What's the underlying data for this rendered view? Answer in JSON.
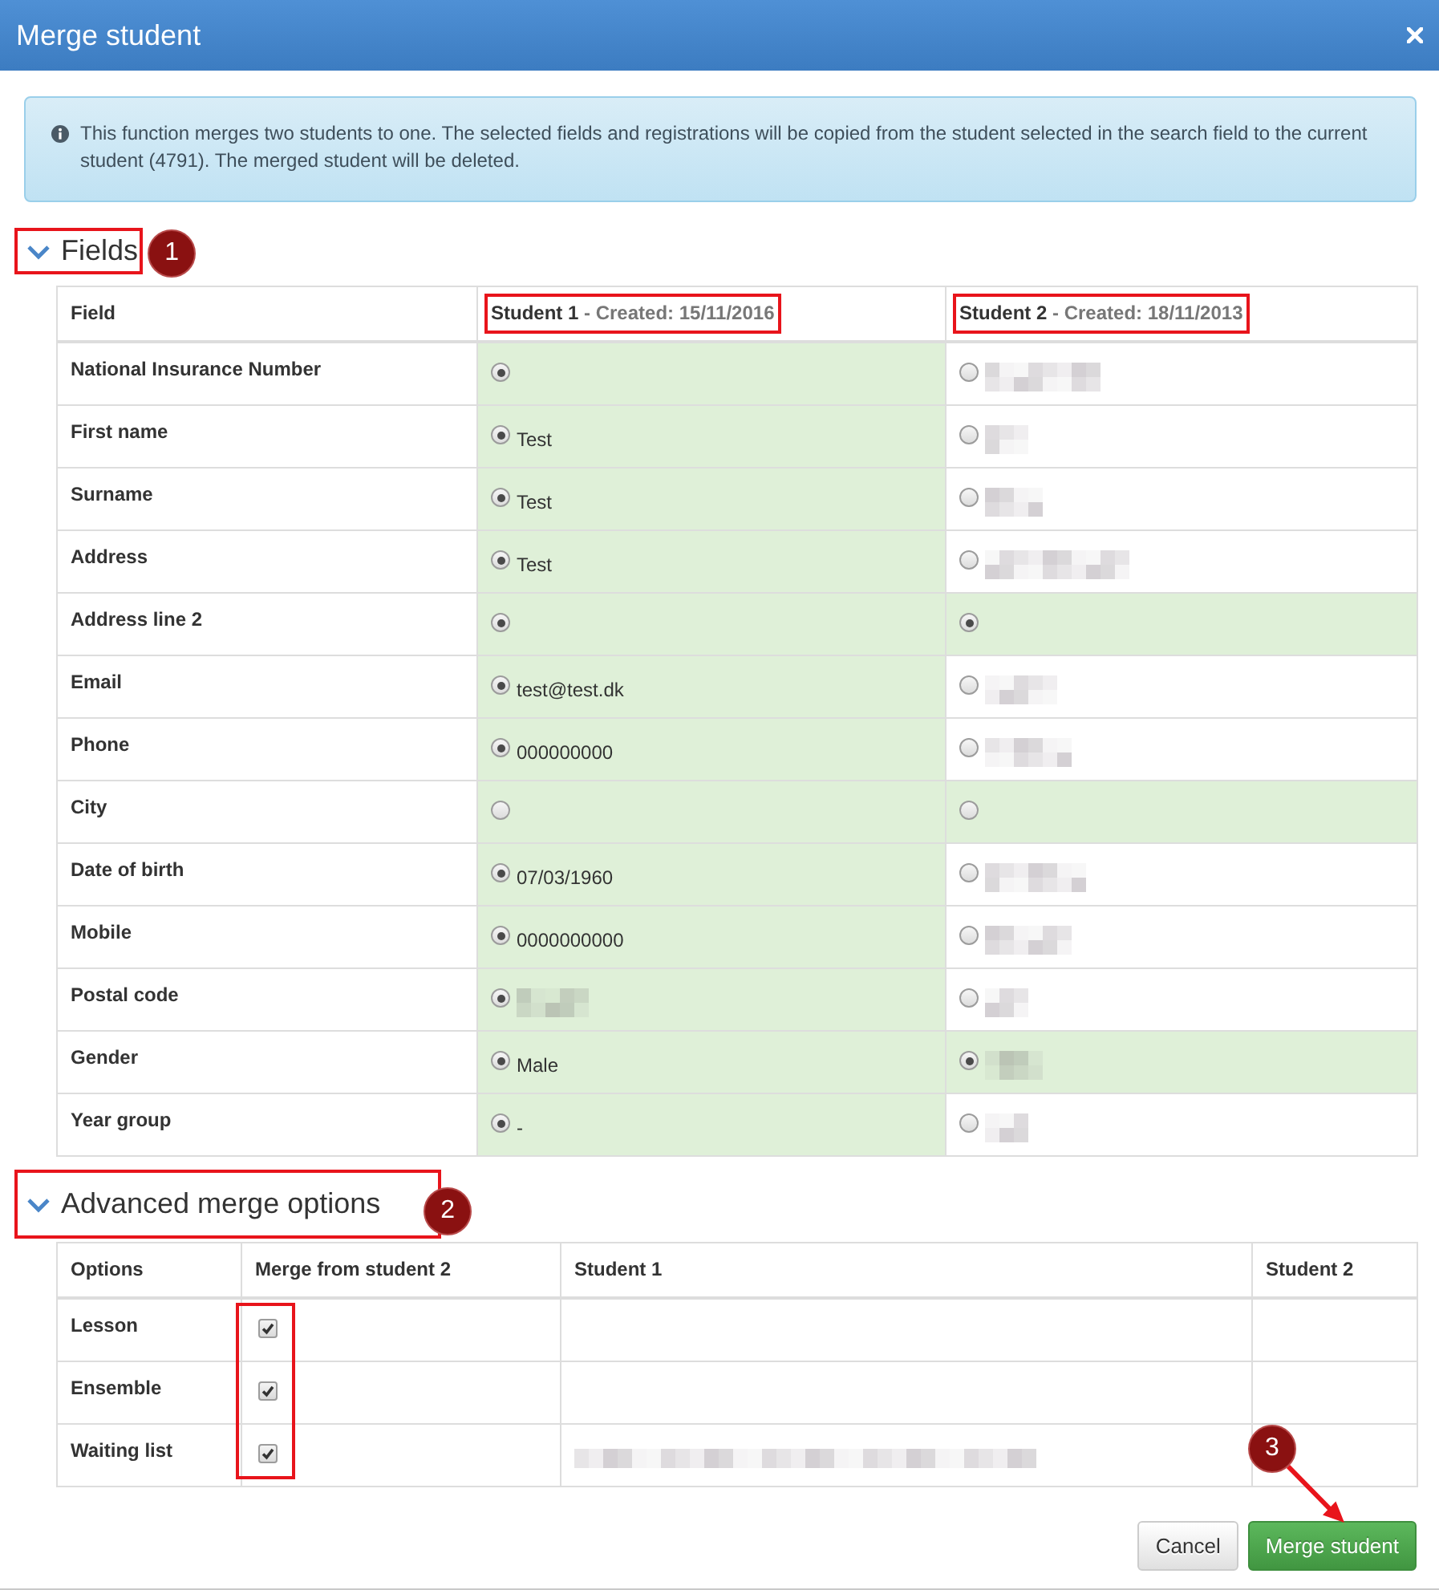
{
  "dialog": {
    "title": "Merge student"
  },
  "info": {
    "text": "This function merges two students to one. The selected fields and registrations will be copied from the student selected in the search field to the current student (4791). The merged student will be deleted."
  },
  "fields_section": {
    "title": "Fields",
    "expanded": true,
    "annotated": true,
    "badge": "1",
    "columns": [
      {
        "label": "Field",
        "annotated": false
      },
      {
        "label": "Student 1",
        "created": "- Created: 15/11/2016",
        "annotated": true
      },
      {
        "label": "Student 2",
        "created": "- Created: 18/11/2013",
        "annotated": true
      }
    ],
    "rows": [
      {
        "field": "National Insurance Number",
        "student_1": {
          "selected": true,
          "highlighted": true
        },
        "student_2": {
          "selected": false,
          "highlighted": false,
          "redacted": true
        }
      },
      {
        "field": "First name",
        "student_1": {
          "selected": true,
          "highlighted": true,
          "value": "Test"
        },
        "student_2": {
          "selected": false,
          "highlighted": false,
          "redacted": true
        }
      },
      {
        "field": "Surname",
        "student_1": {
          "selected": true,
          "highlighted": true,
          "value": "Test"
        },
        "student_2": {
          "selected": false,
          "highlighted": false,
          "redacted": true
        }
      },
      {
        "field": "Address",
        "student_1": {
          "selected": true,
          "highlighted": true,
          "value": "Test"
        },
        "student_2": {
          "selected": false,
          "highlighted": false,
          "redacted": true
        }
      },
      {
        "field": "Address line 2",
        "student_1": {
          "selected": true,
          "highlighted": true
        },
        "student_2": {
          "selected": true,
          "highlighted": true
        }
      },
      {
        "field": "Email",
        "student_1": {
          "selected": true,
          "highlighted": true,
          "value": "test@test.dk"
        },
        "student_2": {
          "selected": false,
          "highlighted": false,
          "redacted": true
        }
      },
      {
        "field": "Phone",
        "student_1": {
          "selected": true,
          "highlighted": true,
          "value": "000000000"
        },
        "student_2": {
          "selected": false,
          "highlighted": false,
          "redacted": true
        }
      },
      {
        "field": "City",
        "student_1": {
          "selected": false,
          "highlighted": true
        },
        "student_2": {
          "selected": false,
          "highlighted": true
        }
      },
      {
        "field": "Date of birth",
        "student_1": {
          "selected": true,
          "highlighted": true,
          "value": "07/03/1960"
        },
        "student_2": {
          "selected": false,
          "highlighted": false,
          "redacted": true
        }
      },
      {
        "field": "Mobile",
        "student_1": {
          "selected": true,
          "highlighted": true,
          "value": "0000000000"
        },
        "student_2": {
          "selected": false,
          "highlighted": false,
          "redacted": true
        }
      },
      {
        "field": "Postal code",
        "student_1": {
          "selected": true,
          "highlighted": true,
          "redacted": true
        },
        "student_2": {
          "selected": false,
          "highlighted": false,
          "redacted": true
        }
      },
      {
        "field": "Gender",
        "student_1": {
          "selected": true,
          "highlighted": true,
          "value": "Male"
        },
        "student_2": {
          "selected": true,
          "highlighted": true,
          "redacted": true
        }
      },
      {
        "field": "Year group",
        "student_1": {
          "selected": true,
          "highlighted": true,
          "value": "-"
        },
        "student_2": {
          "selected": false,
          "highlighted": false,
          "redacted": true
        }
      }
    ]
  },
  "advanced_section": {
    "title": "Advanced merge options",
    "expanded": true,
    "annotated": true,
    "badge": "2",
    "checkboxes_annotated": true,
    "columns": [
      "Options",
      "Merge from student 2",
      "Student 1",
      "Student 2"
    ],
    "rows": [
      {
        "option": "Lesson",
        "checked": true
      },
      {
        "option": "Ensemble",
        "checked": true
      },
      {
        "option": "Waiting list",
        "checked": true,
        "student_1": {
          "redacted": true
        }
      }
    ]
  },
  "buttons": [
    {
      "label": "Cancel",
      "kind": "default"
    },
    {
      "label": "Merge student",
      "kind": "primary",
      "badge": "3",
      "arrow": true
    }
  ]
}
